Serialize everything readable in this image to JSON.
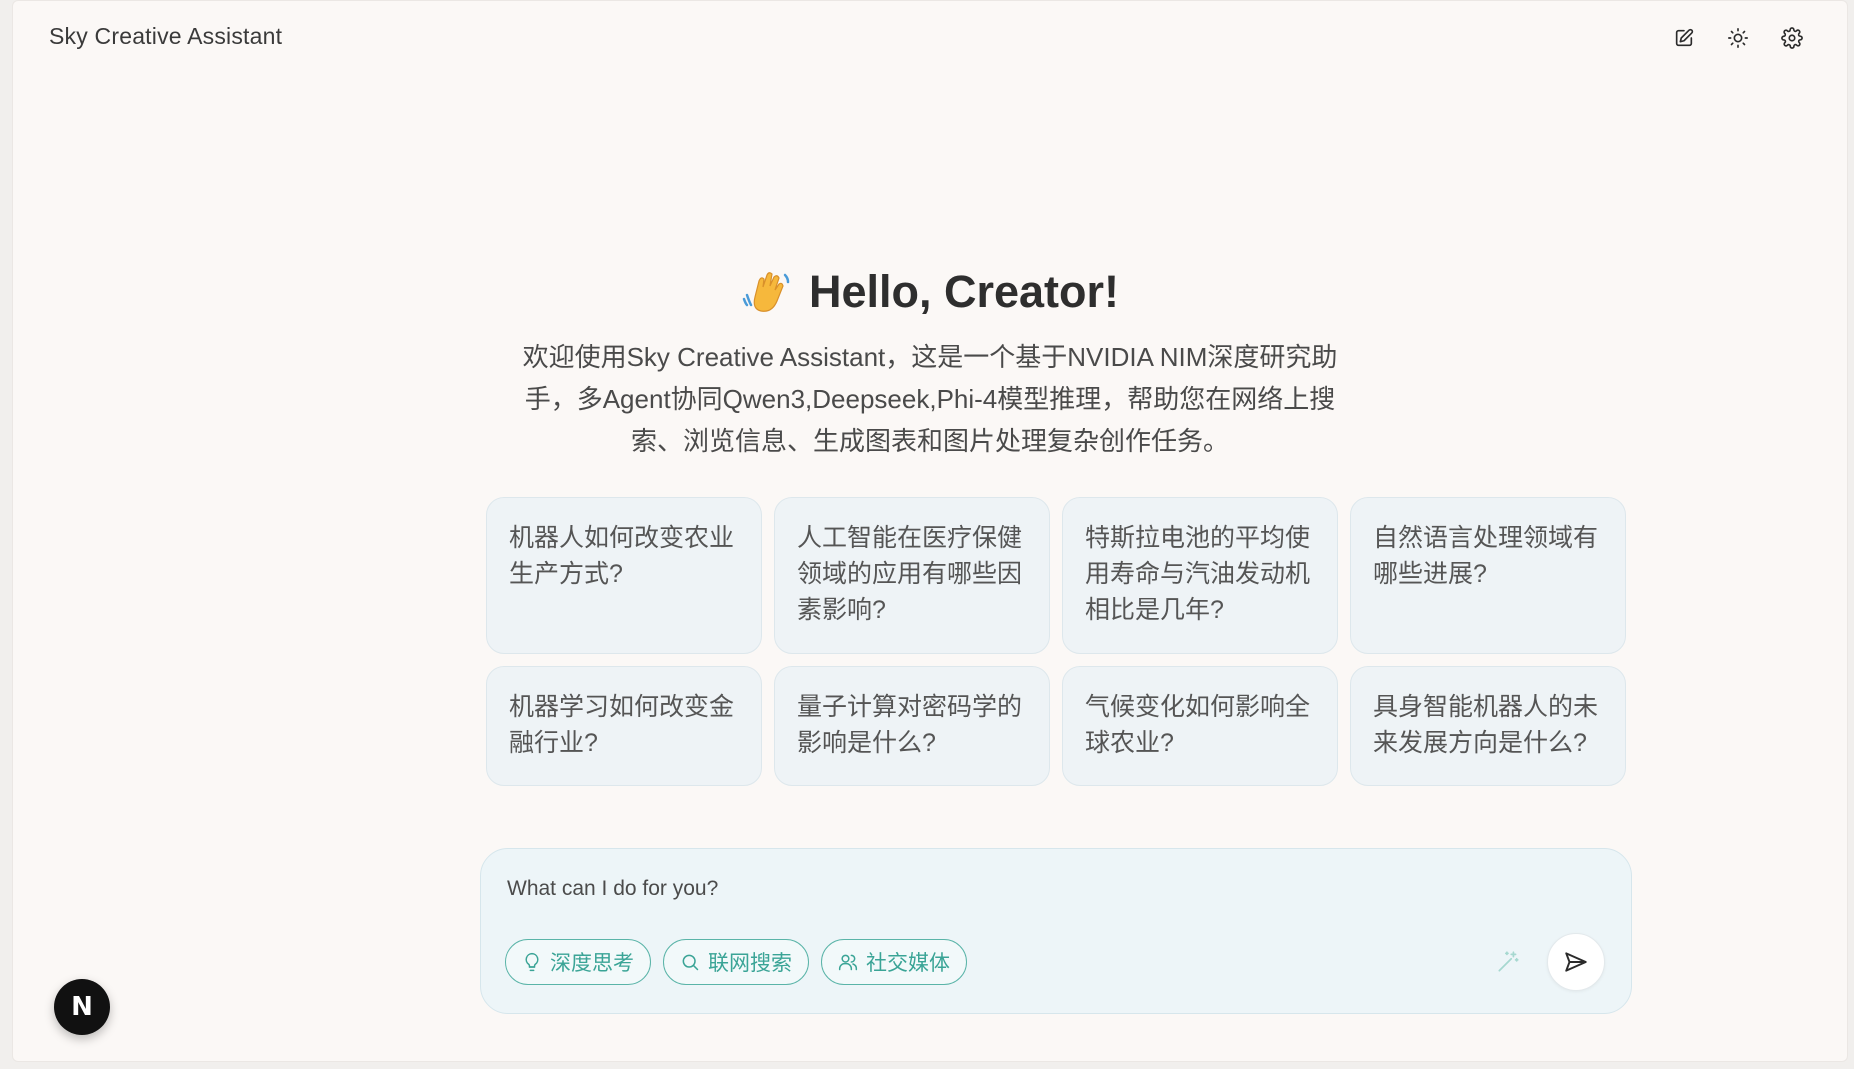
{
  "app": {
    "title": "Sky Creative Assistant"
  },
  "toolbar": {
    "buttons": [
      {
        "name": "new-chat",
        "icon": "edit-icon"
      },
      {
        "name": "theme-toggle",
        "icon": "sun-icon"
      },
      {
        "name": "settings",
        "icon": "gear-icon"
      }
    ]
  },
  "hero": {
    "emoji": "waving-hand-icon",
    "title": "Hello, Creator!",
    "subtitle": "欢迎使用Sky Creative Assistant，这是一个基于NVIDIA NIM深度研究助手，多Agent协同Qwen3,Deepseek,Phi-4模型推理，帮助您在网络上搜索、浏览信息、生成图表和图片处理复杂创作任务。"
  },
  "suggestions": [
    "机器人如何改变农业生产方式?",
    "人工智能在医疗保健领域的应用有哪些因素影响?",
    "特斯拉电池的平均使用寿命与汽油发动机相比是几年?",
    "自然语言处理领域有哪些进展?",
    "机器学习如何改变金融行业?",
    "量子计算对密码学的影响是什么?",
    "气候变化如何影响全球农业?",
    "具身智能机器人的未来发展方向是什么?"
  ],
  "input": {
    "placeholder": "What can I do for you?",
    "value": ""
  },
  "chips": {
    "deep_thinking": "深度思考",
    "web_search": "联网搜索",
    "social_media": "社交媒体"
  },
  "badge": {
    "letter": "N"
  },
  "colors": {
    "accent": "#3aa496",
    "background": "#fbf8f6",
    "card": "#eef3f6"
  }
}
